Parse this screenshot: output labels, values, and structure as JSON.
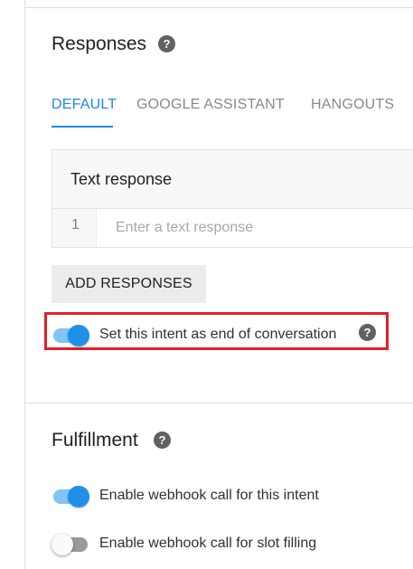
{
  "responses": {
    "title": "Responses",
    "help_icon": "help-circle-icon",
    "tabs": [
      {
        "label": "DEFAULT",
        "active": true
      },
      {
        "label": "GOOGLE ASSISTANT",
        "active": false
      },
      {
        "label": "HANGOUTS",
        "active": false
      }
    ],
    "text_response": {
      "title": "Text response",
      "rows": [
        {
          "number": "1",
          "value": "",
          "placeholder": "Enter a text response"
        }
      ]
    },
    "add_button_label": "ADD RESPONSES",
    "end_conversation": {
      "label": "Set this intent as end of conversation",
      "enabled": true
    }
  },
  "fulfillment": {
    "title": "Fulfillment",
    "help_icon": "help-circle-icon",
    "webhook_call": {
      "label": "Enable webhook call for this intent",
      "enabled": true
    },
    "slot_filling": {
      "label": "Enable webhook call for slot filling",
      "enabled": false
    }
  },
  "colors": {
    "accent": "#1e88e5",
    "toggle_track_on": "#7fc4f5",
    "highlight": "#e31e2b"
  }
}
